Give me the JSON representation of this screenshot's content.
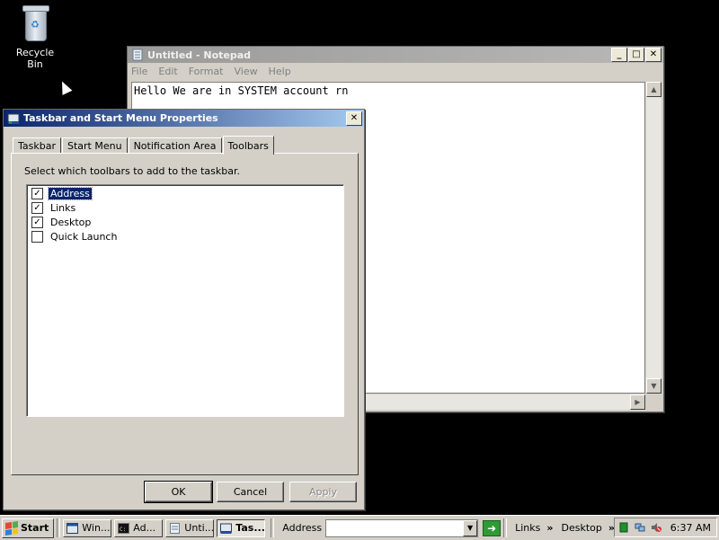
{
  "desktop": {
    "recycle_bin_label": "Recycle Bin"
  },
  "notepad": {
    "title": "Untitled - Notepad",
    "menu": [
      "File",
      "Edit",
      "Format",
      "View",
      "Help"
    ],
    "content": "Hello We are in SYSTEM account rn"
  },
  "dialog": {
    "title": "Taskbar and Start Menu Properties",
    "tabs": [
      "Taskbar",
      "Start Menu",
      "Notification Area",
      "Toolbars"
    ],
    "active_tab": "Toolbars",
    "instruction": "Select which toolbars to add to the taskbar.",
    "toolbars": [
      {
        "label": "Address",
        "checked": true,
        "selected": true
      },
      {
        "label": "Links",
        "checked": true,
        "selected": false
      },
      {
        "label": "Desktop",
        "checked": true,
        "selected": false
      },
      {
        "label": "Quick Launch",
        "checked": false,
        "selected": false
      }
    ],
    "buttons": {
      "ok": "OK",
      "cancel": "Cancel",
      "apply": "Apply"
    }
  },
  "taskbar": {
    "start_label": "Start",
    "tasks": [
      {
        "label": "Win...",
        "active": false
      },
      {
        "label": "Ad...",
        "active": false
      },
      {
        "label": "Unti...",
        "active": false
      },
      {
        "label": "Tas...",
        "active": true
      }
    ],
    "address_label": "Address",
    "links_label": "Links",
    "desktop_label": "Desktop",
    "chevron": "»",
    "clock": "6:37 AM"
  },
  "colors": {
    "desktop_bg": "#000000",
    "active_title_start": "#0a246a",
    "active_title_end": "#a6caf0",
    "inactive_title": "#9a9a9a",
    "face": "#d4d0c8"
  }
}
